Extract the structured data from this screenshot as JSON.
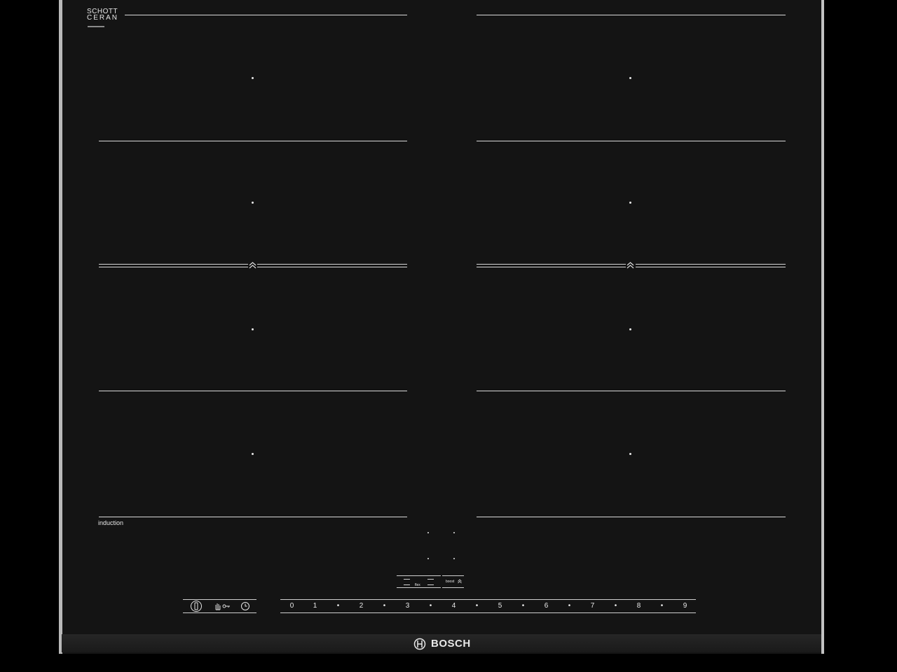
{
  "brand": {
    "name": "BOSCH",
    "glass_brand_line1": "SCHOTT",
    "glass_brand_line2": "CERAN"
  },
  "label": {
    "induction": "induction"
  },
  "flex_label": "flex",
  "boost_label": "boost",
  "power_levels": [
    "0",
    "1",
    "•",
    "2",
    "•",
    "3",
    "•",
    "4",
    "•",
    "5",
    "•",
    "6",
    "•",
    "7",
    "•",
    "8",
    "•",
    "9"
  ],
  "control_icons": [
    "power-icon",
    "child-lock-icon",
    "timer-icon"
  ],
  "colors": {
    "glass": "#141414",
    "lines": "#d8d8d8",
    "frame": "#b9b9b9"
  }
}
